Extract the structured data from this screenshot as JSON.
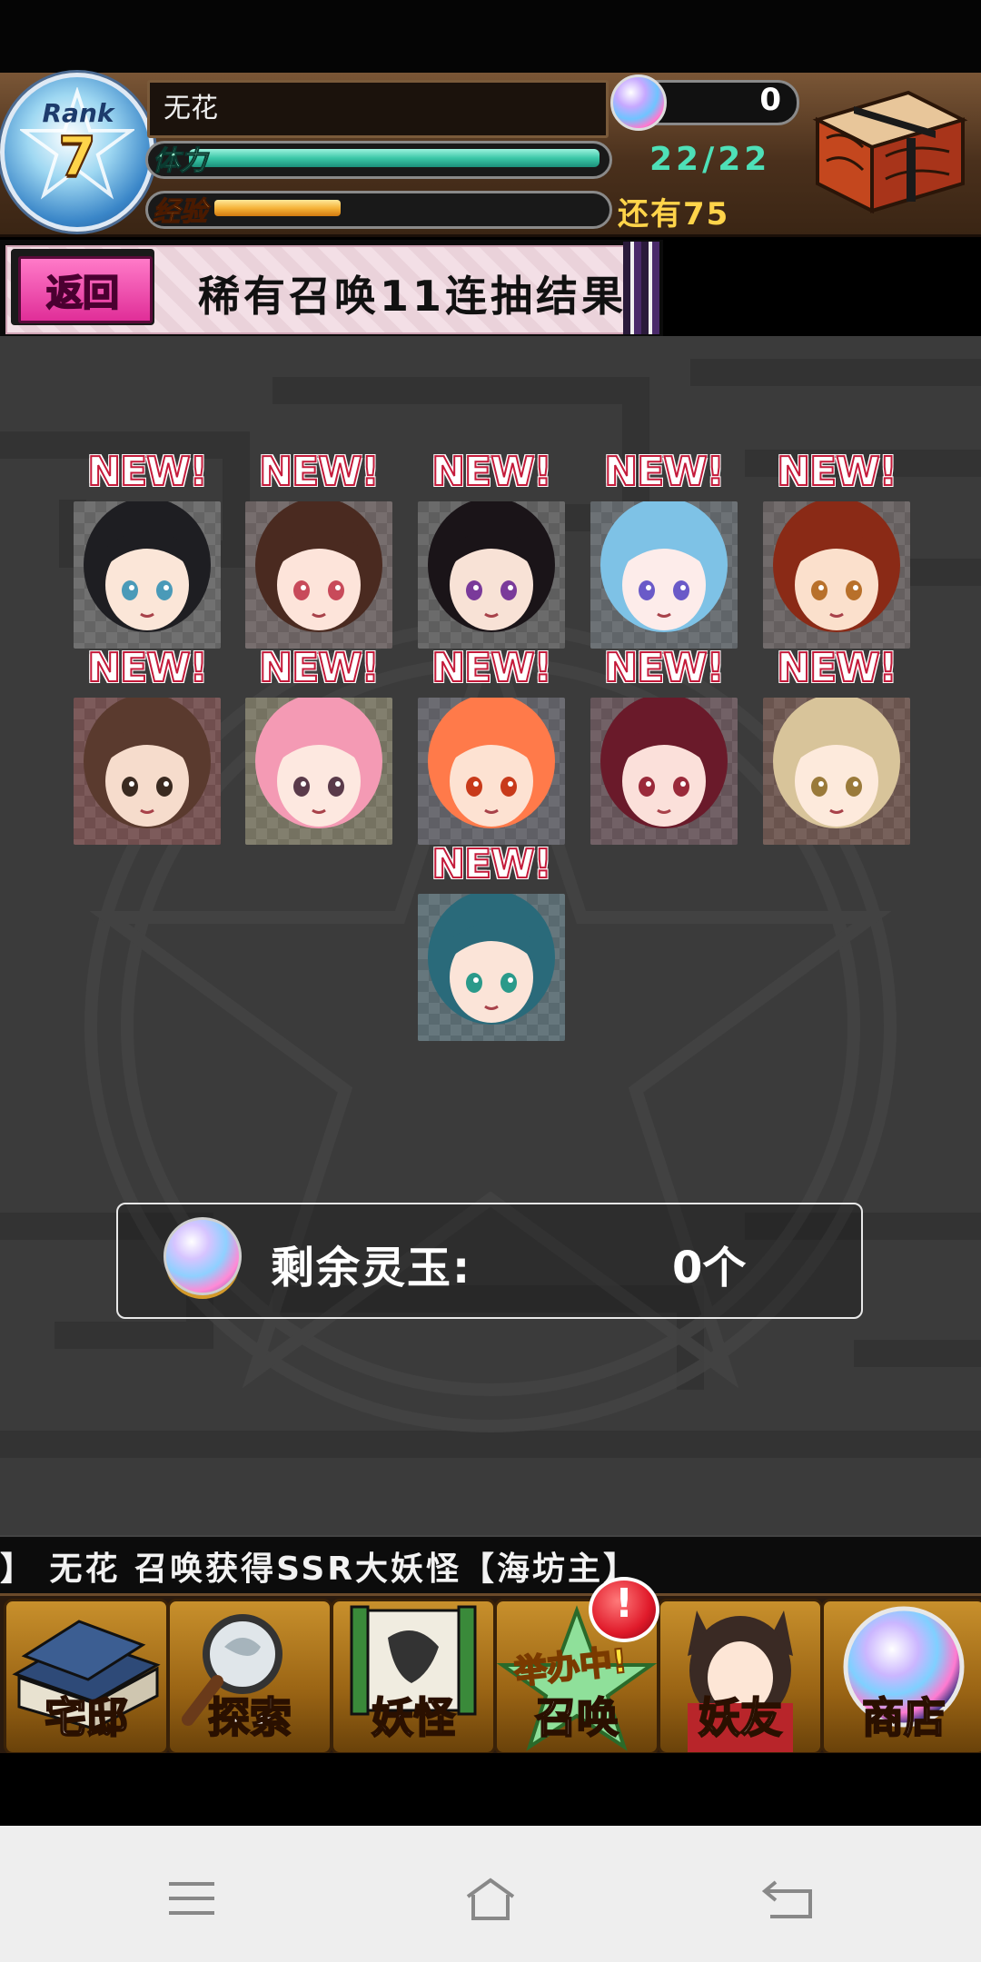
{
  "header": {
    "rank_label": "Rank",
    "rank_value": "7",
    "player_name": "无花",
    "stamina_label": "体力",
    "stamina_value": "22/22",
    "stamina_fraction": 1.0,
    "exp_label": "经验",
    "exp_remaining": "还有75",
    "exp_fraction": 0.33,
    "orb_count": "0"
  },
  "title_bar": {
    "back_label": "返回",
    "title": "稀有召唤11连抽结果"
  },
  "results": {
    "badge_text": "NEW!",
    "cards": [
      {
        "name": "black-hair-girl"
      },
      {
        "name": "brown-hair-girl"
      },
      {
        "name": "dark-hair-boy"
      },
      {
        "name": "blue-hair-girl"
      },
      {
        "name": "fox-ear-girl"
      },
      {
        "name": "short-hair-boy"
      },
      {
        "name": "pink-hair-girl"
      },
      {
        "name": "orange-hair-boy"
      },
      {
        "name": "crimson-hair-girl"
      },
      {
        "name": "blonde-girl"
      },
      {
        "name": "shark-hood-kid"
      }
    ]
  },
  "remaining": {
    "label": "剩余灵玉:",
    "value": "0个"
  },
  "ticker": {
    "text": "】      无花 召唤获得SSR大妖怪【海坊主】"
  },
  "nav": {
    "items": [
      {
        "label": "宅邸",
        "icon": "mansion-icon"
      },
      {
        "label": "探索",
        "icon": "magnifier-icon"
      },
      {
        "label": "妖怪",
        "icon": "scroll-icon"
      },
      {
        "label": "召唤",
        "icon": "star-icon"
      },
      {
        "label": "妖友",
        "icon": "fox-girl-icon"
      },
      {
        "label": "商店",
        "icon": "orb-icon"
      }
    ],
    "alert_mark": "!",
    "event_label": "举办中!"
  },
  "colors": {
    "stamina": "#3cc8a8",
    "exp": "#f6b43a",
    "badge_outline": "#c41a3a",
    "back_button": "#e02e98"
  }
}
